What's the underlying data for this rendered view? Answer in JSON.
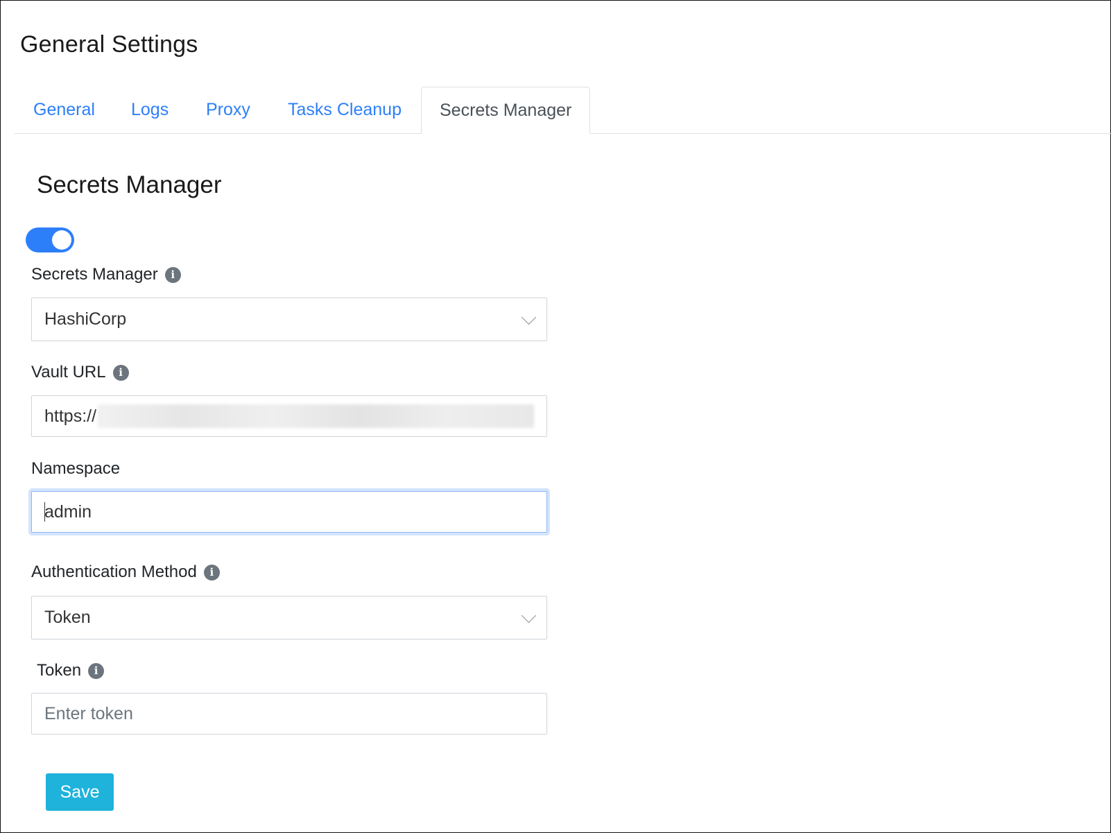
{
  "page_title": "General Settings",
  "tabs": [
    {
      "label": "General"
    },
    {
      "label": "Logs"
    },
    {
      "label": "Proxy"
    },
    {
      "label": "Tasks Cleanup"
    },
    {
      "label": "Secrets Manager",
      "active": true
    }
  ],
  "section_title": "Secrets Manager",
  "toggle": {
    "enabled": true
  },
  "form": {
    "secrets_manager": {
      "label": "Secrets Manager",
      "value": "HashiCorp"
    },
    "vault_url": {
      "label": "Vault URL",
      "value": "https://"
    },
    "namespace": {
      "label": "Namespace",
      "value": "admin"
    },
    "auth_method": {
      "label": "Authentication Method",
      "value": "Token"
    },
    "token": {
      "label": "Token",
      "placeholder": "Enter token",
      "value": ""
    }
  },
  "save_label": "Save",
  "colors": {
    "accent": "#2d7ff9",
    "save_button": "#1fb3dc",
    "info_icon": "#6c757d"
  },
  "icons": {
    "info": "info-circle-icon",
    "dropdown": "chevron-down-icon"
  }
}
